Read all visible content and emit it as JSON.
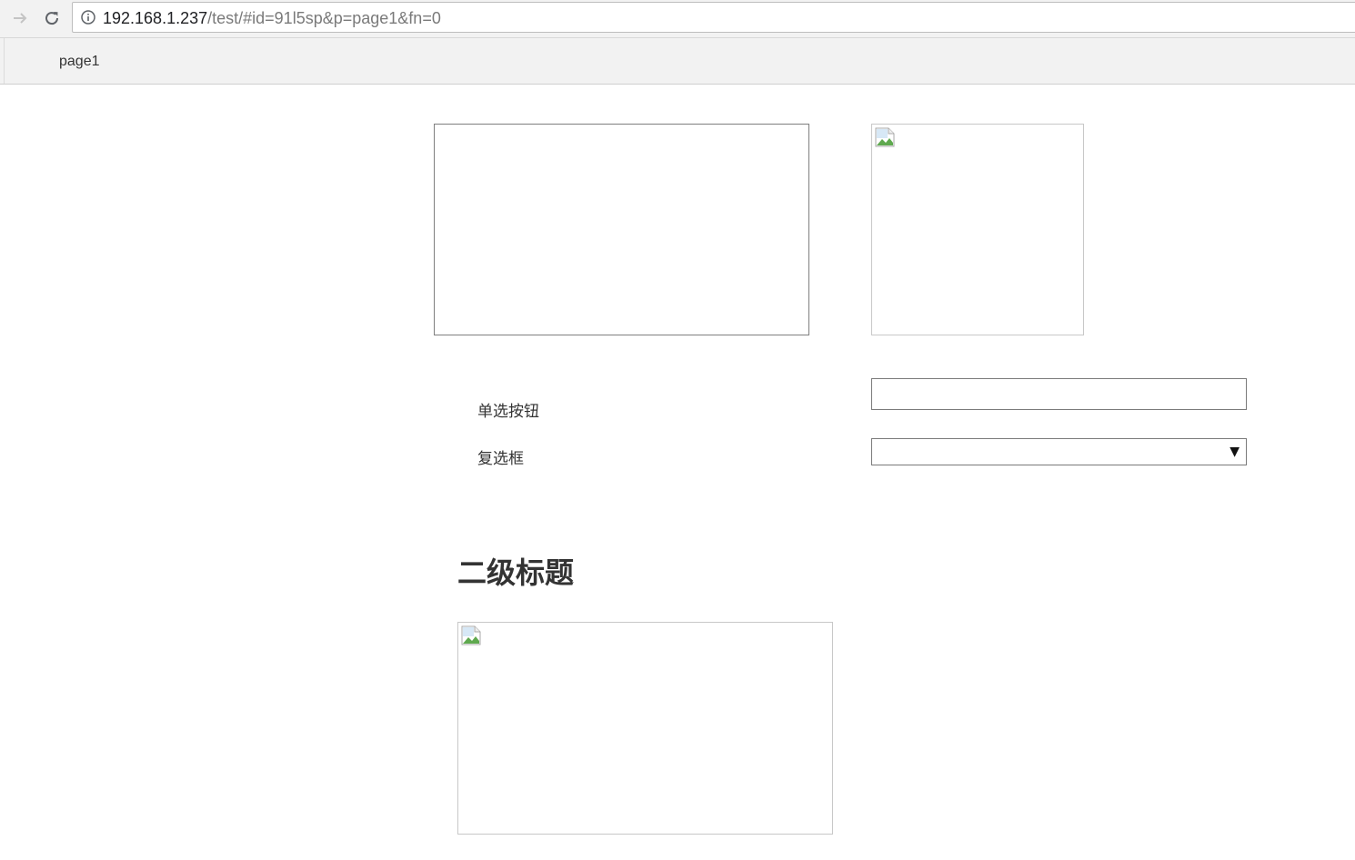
{
  "browser": {
    "url_host": "192.168.1.237",
    "url_path": "/test/#id=91l5sp&p=page1&fn=0"
  },
  "page_tabs": [
    {
      "label": "page1"
    }
  ],
  "form": {
    "radio_label": "单选按钮",
    "checkbox_label": "复选框",
    "text_value": "",
    "select_value": ""
  },
  "heading": {
    "text": "二级标题"
  },
  "icons": {
    "forward": "arrow-right-icon",
    "reload": "reload-icon",
    "info": "info-icon",
    "broken_image": "broken-image-icon",
    "dropdown": "triangle-down-icon"
  }
}
